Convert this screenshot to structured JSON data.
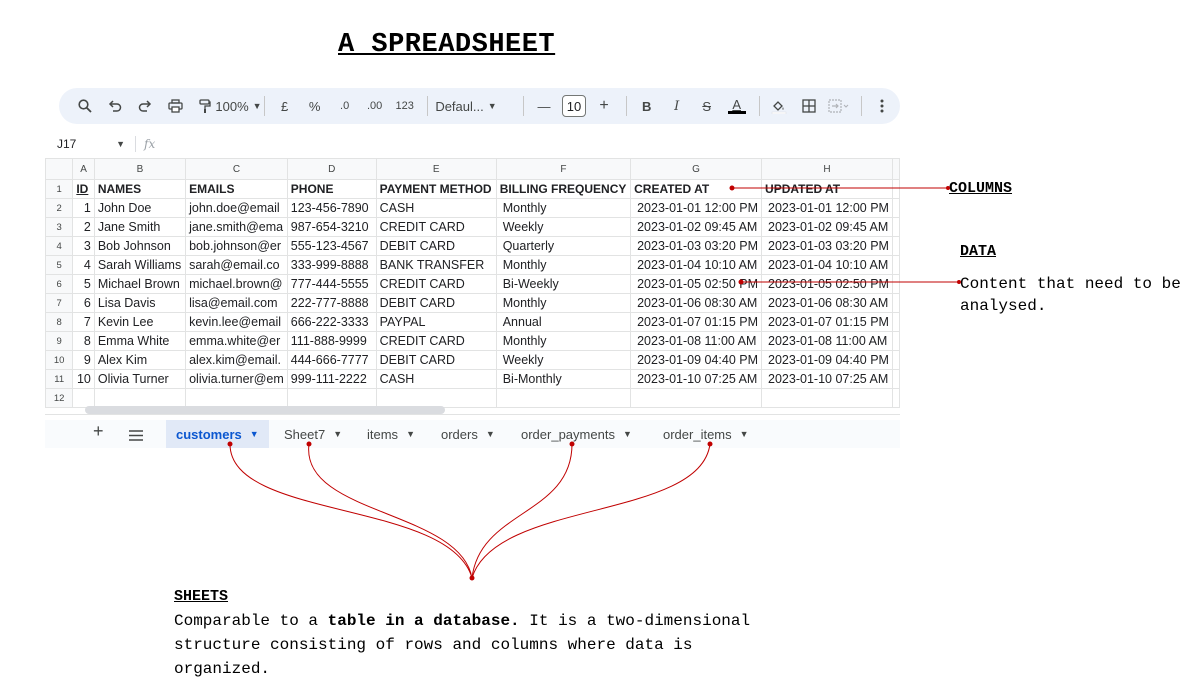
{
  "page": {
    "title": "A SPREADSHEET"
  },
  "toolbar": {
    "zoom": "100%",
    "currency": "£",
    "percent": "%",
    "dec_decrease": ".0",
    "dec_increase": ".00",
    "number_format": "123",
    "font_name": "Defaul...",
    "font_size": "10",
    "bold": "B",
    "italic": "I",
    "strike": "S",
    "text_color": "A"
  },
  "formula_bar": {
    "cell_ref": "J17",
    "fx": "fx"
  },
  "grid": {
    "column_letters": [
      "A",
      "B",
      "C",
      "D",
      "E",
      "F",
      "G",
      "H"
    ],
    "row_numbers": [
      "1",
      "2",
      "3",
      "4",
      "5",
      "6",
      "7",
      "8",
      "9",
      "10",
      "11",
      "12"
    ],
    "headers": [
      "ID",
      "NAMES",
      "EMAILS",
      "PHONE",
      "PAYMENT METHOD",
      "BILLING FREQUENCY",
      "CREATED AT",
      "UPDATED AT"
    ],
    "rows": [
      [
        "1",
        "John Doe",
        "john.doe@email",
        "123-456-7890",
        "CASH",
        "Monthly",
        "2023-01-01 12:00 PM",
        "2023-01-01 12:00 PM"
      ],
      [
        "2",
        "Jane Smith",
        "jane.smith@ema",
        "987-654-3210",
        "CREDIT CARD",
        "Weekly",
        "2023-01-02 09:45 AM",
        "2023-01-02 09:45 AM"
      ],
      [
        "3",
        "Bob Johnson",
        "bob.johnson@er",
        "555-123-4567",
        "DEBIT CARD",
        "Quarterly",
        "2023-01-03 03:20 PM",
        "2023-01-03 03:20 PM"
      ],
      [
        "4",
        "Sarah Williams",
        "sarah@email.co",
        "333-999-8888",
        "BANK TRANSFER",
        "Monthly",
        "2023-01-04 10:10 AM",
        "2023-01-04 10:10 AM"
      ],
      [
        "5",
        "Michael Brown",
        "michael.brown@",
        "777-444-5555",
        "CREDIT CARD",
        "Bi-Weekly",
        "2023-01-05 02:50 PM",
        "2023-01-05 02:50 PM"
      ],
      [
        "6",
        "Lisa Davis",
        "lisa@email.com",
        "222-777-8888",
        "DEBIT CARD",
        "Monthly",
        "2023-01-06 08:30 AM",
        "2023-01-06 08:30 AM"
      ],
      [
        "7",
        "Kevin Lee",
        "kevin.lee@email",
        "666-222-3333",
        "PAYPAL",
        "Annual",
        "2023-01-07 01:15 PM",
        "2023-01-07 01:15 PM"
      ],
      [
        "8",
        "Emma White",
        "emma.white@er",
        "111-888-9999",
        "CREDIT CARD",
        "Monthly",
        "2023-01-08 11:00 AM",
        "2023-01-08 11:00 AM"
      ],
      [
        "9",
        "Alex Kim",
        "alex.kim@email.",
        "444-666-7777",
        "DEBIT CARD",
        "Weekly",
        "2023-01-09 04:40 PM",
        "2023-01-09 04:40 PM"
      ],
      [
        "10",
        "Olivia Turner",
        "olivia.turner@em",
        "999-111-2222",
        "CASH",
        "Bi-Monthly",
        "2023-01-10 07:25 AM",
        "2023-01-10 07:25 AM"
      ]
    ]
  },
  "sheet_tabs": {
    "active": "customers",
    "tabs": [
      "customers",
      "Sheet7",
      "items",
      "orders",
      "order_payments",
      "order_items"
    ]
  },
  "annotations": {
    "columns": {
      "heading": "COLUMNS"
    },
    "data": {
      "heading": "DATA",
      "body": "Content that need to be analysed."
    },
    "sheets": {
      "heading": "SHEETS",
      "body_pre": "Comparable to a ",
      "body_bold": "table in a database.",
      "body_post": " It is a two-dimensional structure consisting of rows and columns where data is organized."
    }
  },
  "colors": {
    "annotation_line": "#c00000",
    "active_tab_bg": "#e1e9f7",
    "active_tab_text": "#0b57d0",
    "toolbar_bg": "#edf2fa"
  }
}
